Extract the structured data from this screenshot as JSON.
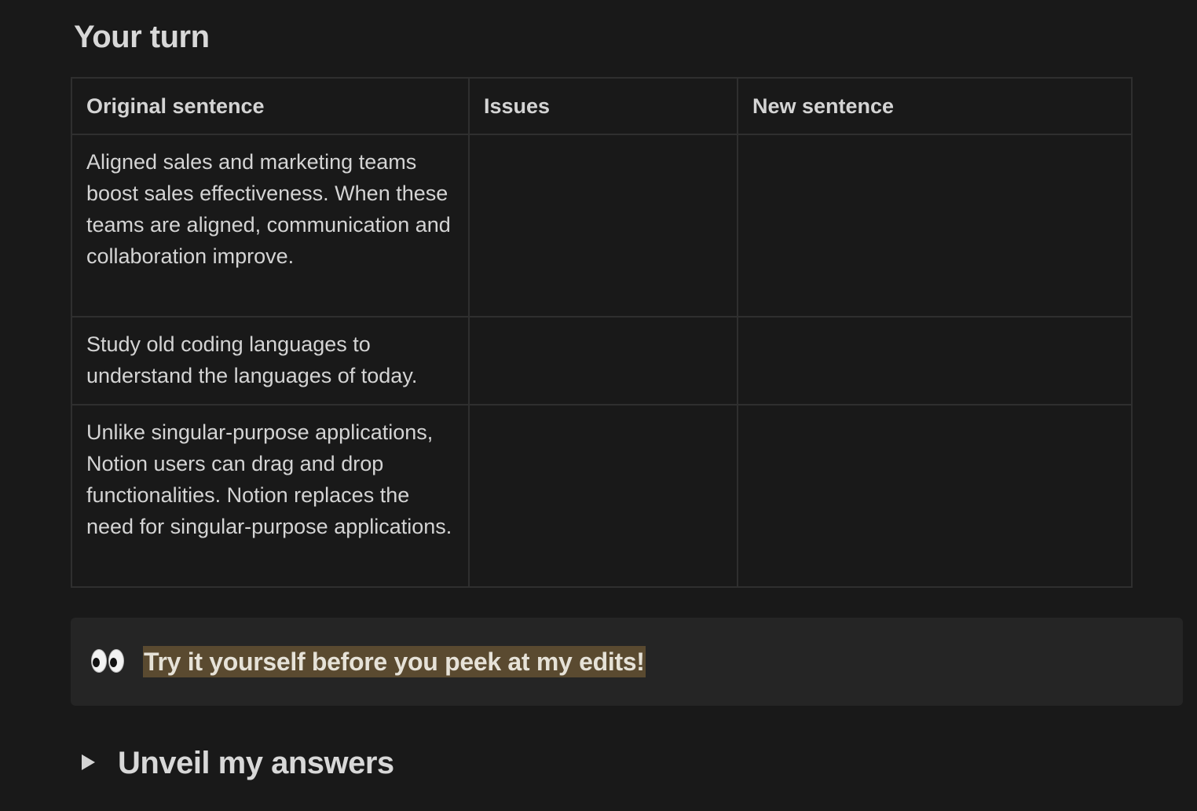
{
  "section": {
    "heading": "Your turn"
  },
  "table": {
    "headers": [
      "Original sentence",
      "Issues",
      "New sentence"
    ],
    "rows": [
      [
        "Aligned sales and marketing teams boost sales effectiveness. When these teams are aligned, communication and collaboration improve.",
        "",
        ""
      ],
      [
        "Study old coding languages to understand the languages of today.",
        "",
        ""
      ],
      [
        "Unlike singular-purpose applications, Notion users can drag and drop functionalities. Notion replaces the need for singular-purpose applications.",
        "",
        ""
      ]
    ]
  },
  "callout": {
    "icon": "eyes-icon",
    "text": "Try it yourself before you peek at my edits!",
    "highlight_color": "#5a4a30"
  },
  "toggle": {
    "icon": "triangle-right-icon",
    "title": "Unveil my answers"
  },
  "colors": {
    "background": "#191919",
    "text": "#d4d4d4",
    "border": "#2f2f2f",
    "callout_background": "#252525"
  }
}
